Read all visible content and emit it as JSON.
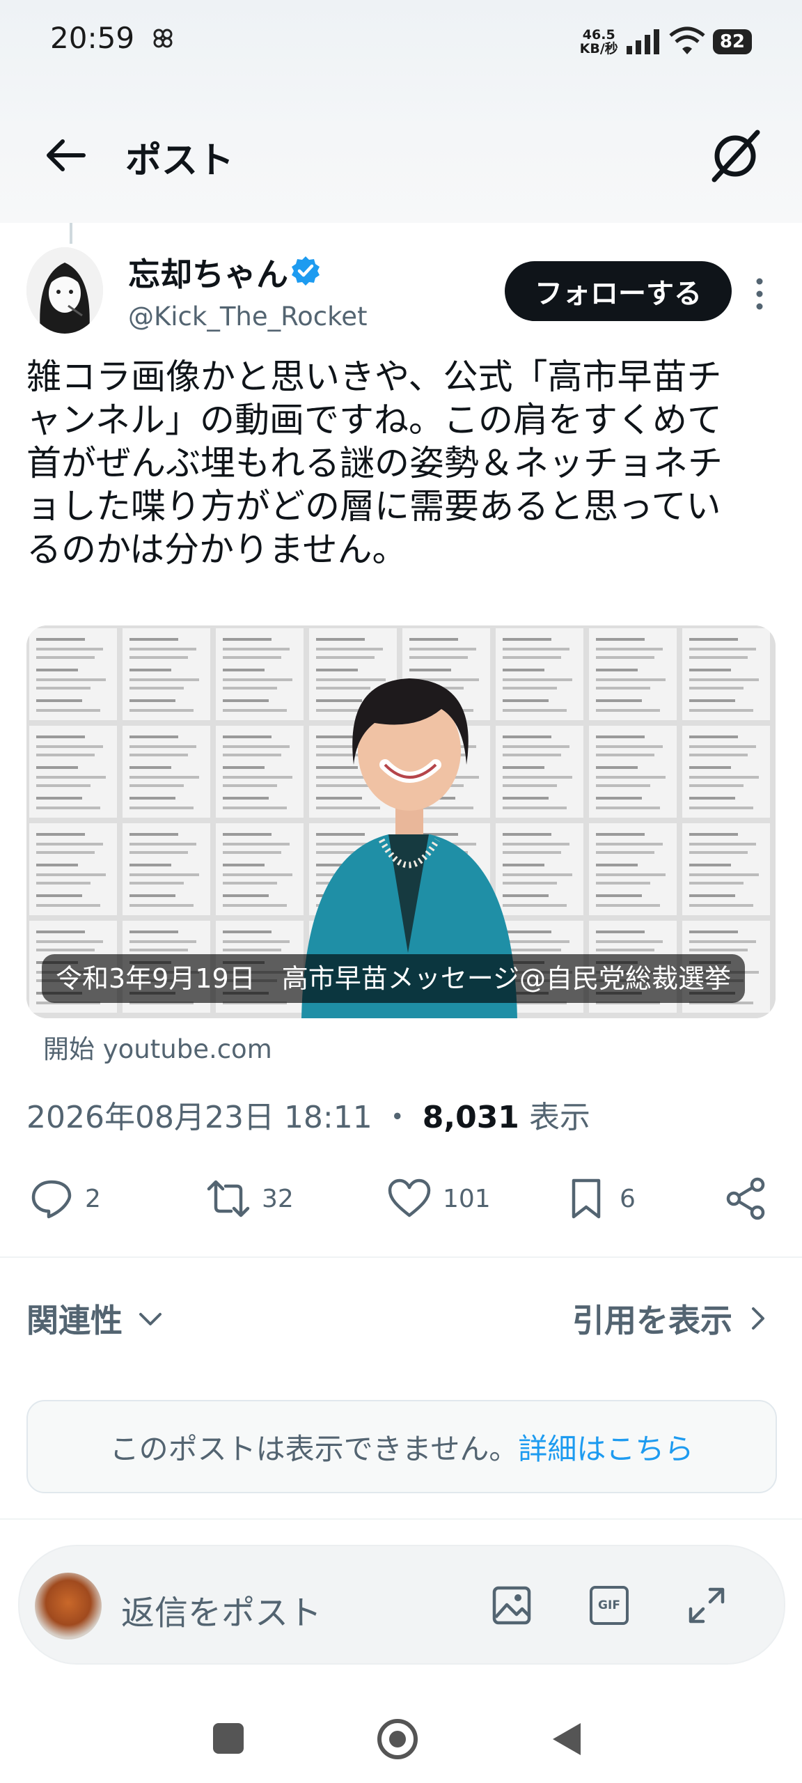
{
  "status_bar": {
    "time": "20:59",
    "net_speed_value": "46.5",
    "net_speed_unit": "KB/秒",
    "battery": "82"
  },
  "header": {
    "title": "ポスト",
    "back_icon": "arrow-left-icon",
    "grok_icon": "grok-icon"
  },
  "post": {
    "display_name": "忘却ちゃん",
    "handle": "@Kick_The_Rocket",
    "follow_label": "フォローする",
    "text_lines": [
      "雑コラ画像かと思いきや、公式「高市早苗チ",
      "ャンネル」の動画ですね。この肩をすくめて",
      "首がぜんぶ埋もれる謎の姿勢＆ネッチョネチ",
      "ョした喋り方がどの層に需要あると思ってい",
      "るのかは分かりません。"
    ],
    "card": {
      "caption": "令和3年9月19日　高市早苗メッセージ@自民党総裁選挙",
      "source": "開始 youtube.com"
    },
    "timestamp": "2026年08月23日 18:11",
    "separator": "・",
    "views_count": "8,031",
    "views_label": "表示",
    "actions": {
      "replies": "2",
      "reposts": "32",
      "likes": "101",
      "bookmarks": "6"
    }
  },
  "replies_section": {
    "sort_label": "関連性",
    "quotes_label": "引用を表示",
    "unavailable_text": "このポストは表示できません。",
    "details_link": "詳細はこちら"
  },
  "composer": {
    "placeholder": "返信をポスト",
    "gif_label": "GIF"
  },
  "colors": {
    "accent": "#1d9bf0",
    "text_primary": "#0f1419",
    "text_secondary": "#536471",
    "follow_button_bg": "#0f1419"
  }
}
